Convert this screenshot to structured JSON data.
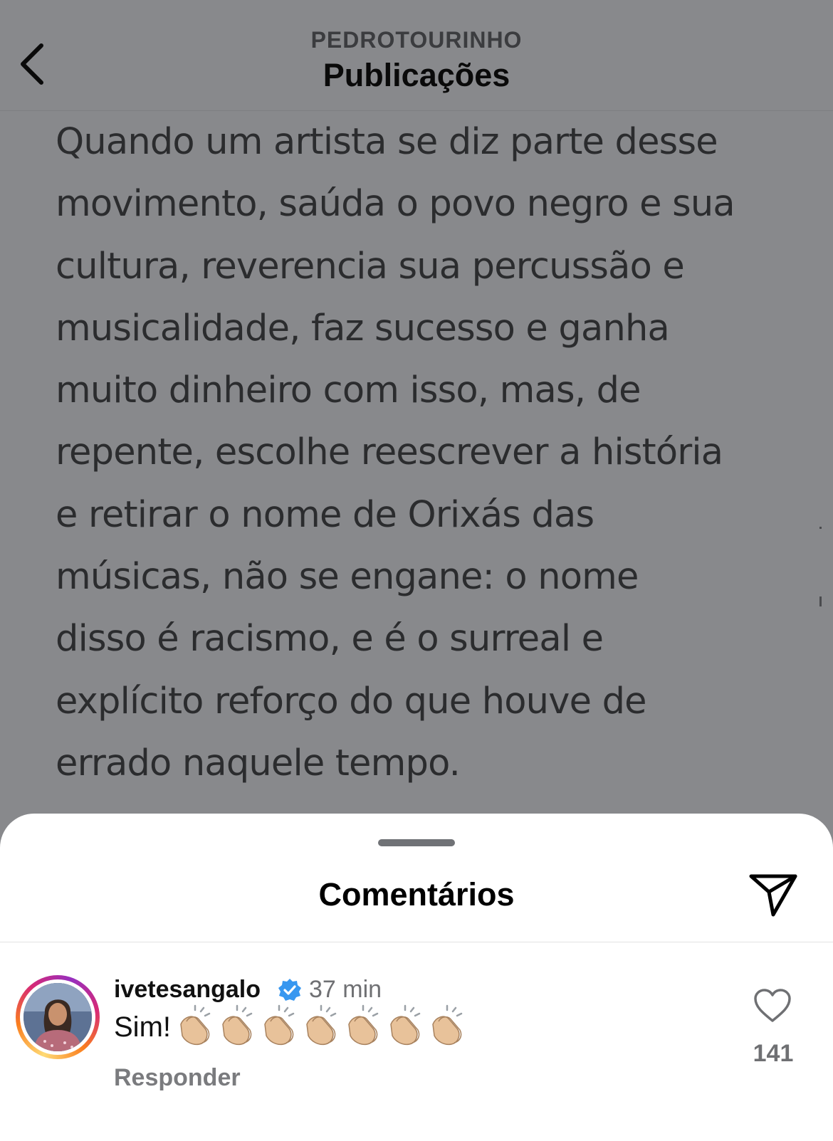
{
  "header": {
    "account": "PEDROTOURINHO",
    "title": "Publicações",
    "back_icon": "chevron-left-icon"
  },
  "post": {
    "lines": [
      "Quando um artista se diz parte desse",
      "movimento, saúda o povo negro e sua",
      "cultura, reverencia sua percussão e",
      "musicalidade, faz sucesso e ganha",
      "muito dinheiro com isso, mas, de",
      "repente, escolhe reescrever a história",
      "e retirar o nome de Orixás das",
      "músicas, não se engane: o nome",
      "disso é racismo, e é o surreal e",
      "explícito reforço do que houve de",
      "errado naquele tempo."
    ]
  },
  "comments_sheet": {
    "title": "Comentários",
    "share_icon": "paper-plane-icon",
    "comment": {
      "username": "ivetesangalo",
      "verified_icon": "verified-badge-icon",
      "time": "37 min",
      "text": "Sim!",
      "emoji": [
        "clapping-hands-icon",
        "clapping-hands-icon",
        "clapping-hands-icon",
        "clapping-hands-icon",
        "clapping-hands-icon",
        "clapping-hands-icon",
        "clapping-hands-icon"
      ],
      "reply_label": "Responder",
      "like_icon": "heart-outline-icon",
      "like_count": "141"
    }
  },
  "colors": {
    "dim_background": "#88898c",
    "sheet_background": "#ffffff",
    "verified_blue": "#3797f0",
    "skin_tone": "#e8c29a"
  }
}
